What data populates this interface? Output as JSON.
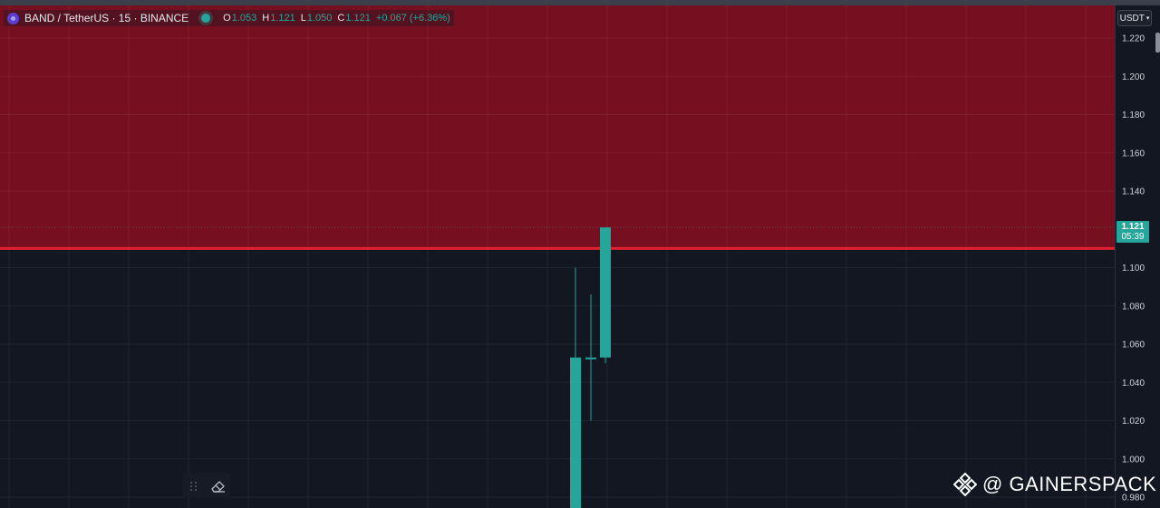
{
  "legend": {
    "title": "BAND / TetherUS · 15 · BINANCE",
    "open_key": "O",
    "open": "1.053",
    "high_key": "H",
    "high": "1.121",
    "low_key": "L",
    "low": "1.050",
    "close_key": "C",
    "close": "1.121",
    "change": "+0.067 (+6.36%)"
  },
  "currency_selector": "USDT",
  "last_price": {
    "price": "1.121",
    "countdown": "05:39"
  },
  "watermark": "@ GAINERSPACK",
  "colors": {
    "background": "#131722",
    "zone_fill": "#761020",
    "zone_line": "#e3212f",
    "bull": "#26a69a",
    "grid": "#1f2431"
  },
  "chart_data": {
    "type": "candlestick",
    "y_axis": {
      "ticks": [
        "1.220",
        "1.200",
        "1.180",
        "1.160",
        "1.140",
        "1.100",
        "1.080",
        "1.060",
        "1.040",
        "1.020",
        "1.000",
        "0.980"
      ]
    },
    "resistance_zone": {
      "bottom": 1.11
    },
    "candles": [
      {
        "open": 0.97,
        "high": 1.1,
        "low": 0.97,
        "close": 1.053
      },
      {
        "open": 1.053,
        "high": 1.086,
        "low": 1.02,
        "close": 1.053
      },
      {
        "open": 1.053,
        "high": 1.121,
        "low": 1.05,
        "close": 1.121
      }
    ]
  }
}
